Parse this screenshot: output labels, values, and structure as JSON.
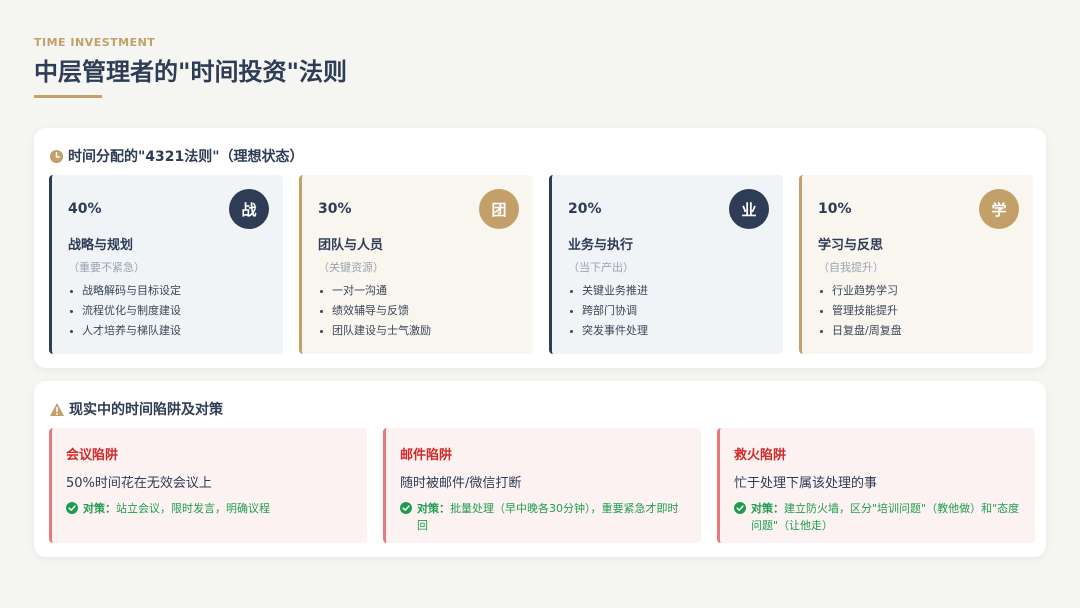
{
  "header": {
    "eyebrow": "TIME INVESTMENT",
    "title": "中层管理者的\"时间投资\"法则"
  },
  "allocation": {
    "heading": "时间分配的\"4321法则\"（理想状态）",
    "icon": "clock-icon",
    "cards": [
      {
        "percent": "40%",
        "badge": "战",
        "title": "战略与规划",
        "subtitle": "（重要不紧急）",
        "items": [
          "战略解码与目标设定",
          "流程优化与制度建设",
          "人才培养与梯队建设"
        ],
        "accent": "#2e3c55"
      },
      {
        "percent": "30%",
        "badge": "团",
        "title": "团队与人员",
        "subtitle": "（关键资源）",
        "items": [
          "一对一沟通",
          "绩效辅导与反馈",
          "团队建设与士气激励"
        ],
        "accent": "#c3a06a"
      },
      {
        "percent": "20%",
        "badge": "业",
        "title": "业务与执行",
        "subtitle": "（当下产出）",
        "items": [
          "关键业务推进",
          "跨部门协调",
          "突发事件处理"
        ],
        "accent": "#2e3c55"
      },
      {
        "percent": "10%",
        "badge": "学",
        "title": "学习与反思",
        "subtitle": "（自我提升）",
        "items": [
          "行业趋势学习",
          "管理技能提升",
          "日复盘/周复盘"
        ],
        "accent": "#c3a06a"
      }
    ]
  },
  "traps": {
    "heading": "现实中的时间陷阱及对策",
    "icon": "warning-icon",
    "items": [
      {
        "title": "会议陷阱",
        "desc": "50%时间花在无效会议上",
        "fix_label": "对策：",
        "fix": "站立会议，限时发言，明确议程"
      },
      {
        "title": "邮件陷阱",
        "desc": "随时被邮件/微信打断",
        "fix_label": "对策：",
        "fix": "批量处理（早中晚各30分钟），重要紧急才即时回"
      },
      {
        "title": "救火陷阱",
        "desc": "忙于处理下属该处理的事",
        "fix_label": "对策：",
        "fix": "建立防火墙，区分\"培训问题\"（教他做）和\"态度问题\"（让他走）"
      }
    ]
  },
  "colors": {
    "navy": "#2e3c55",
    "gold": "#c3a06a",
    "trap_red": "#d42a2a",
    "fix_green": "#1f9d4e"
  }
}
